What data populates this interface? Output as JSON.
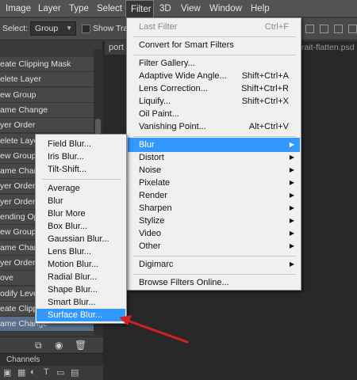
{
  "menubar": {
    "items": [
      "Image",
      "Layer",
      "Type",
      "Select",
      "Filter",
      "3D",
      "View",
      "Window",
      "Help"
    ],
    "active": "Filter"
  },
  "options": {
    "select_label": "Select:",
    "select_value": "Group",
    "show_transform": "Show Trans"
  },
  "document": {
    "tab_label": "port",
    "tab2_label": "rait-flatten.psd @"
  },
  "history": {
    "rows": [
      "eate Clipping Mask",
      "elete Layer",
      "ew Group",
      "ame Change",
      "yer Order",
      "elete Layer",
      "ew Group",
      "ame Change",
      "yer Order",
      "yer Order",
      "ending Optio",
      "ew Group",
      "ame Change",
      "yer Order",
      "ove",
      "odify Levels",
      "eate Clippin",
      "ame Change"
    ],
    "selected_index": 17
  },
  "channels": {
    "label": "Channels"
  },
  "filter_menu": {
    "last_filter": {
      "label": "Last Filter",
      "shortcut": "Ctrl+F"
    },
    "convert": "Convert for Smart Filters",
    "group1": [
      {
        "label": "Filter Gallery...",
        "shortcut": ""
      },
      {
        "label": "Adaptive Wide Angle...",
        "shortcut": "Shift+Ctrl+A"
      },
      {
        "label": "Lens Correction...",
        "shortcut": "Shift+Ctrl+R"
      },
      {
        "label": "Liquify...",
        "shortcut": "Shift+Ctrl+X"
      },
      {
        "label": "Oil Paint...",
        "shortcut": ""
      },
      {
        "label": "Vanishing Point...",
        "shortcut": "Alt+Ctrl+V"
      }
    ],
    "submenus": [
      "Blur",
      "Distort",
      "Noise",
      "Pixelate",
      "Render",
      "Sharpen",
      "Stylize",
      "Video",
      "Other"
    ],
    "digimarc": "Digimarc",
    "browse": "Browse Filters Online...",
    "highlighted": "Blur"
  },
  "blur_menu": {
    "group1": [
      "Field Blur...",
      "Iris Blur...",
      "Tilt-Shift..."
    ],
    "group2": [
      "Average",
      "Blur",
      "Blur More",
      "Box Blur...",
      "Gaussian Blur...",
      "Lens Blur...",
      "Motion Blur...",
      "Radial Blur...",
      "Shape Blur...",
      "Smart Blur...",
      "Surface Blur..."
    ],
    "highlighted": "Surface Blur..."
  },
  "colors": {
    "menu_highlight": "#3399ff",
    "annotation_arrow": "#d42020"
  }
}
